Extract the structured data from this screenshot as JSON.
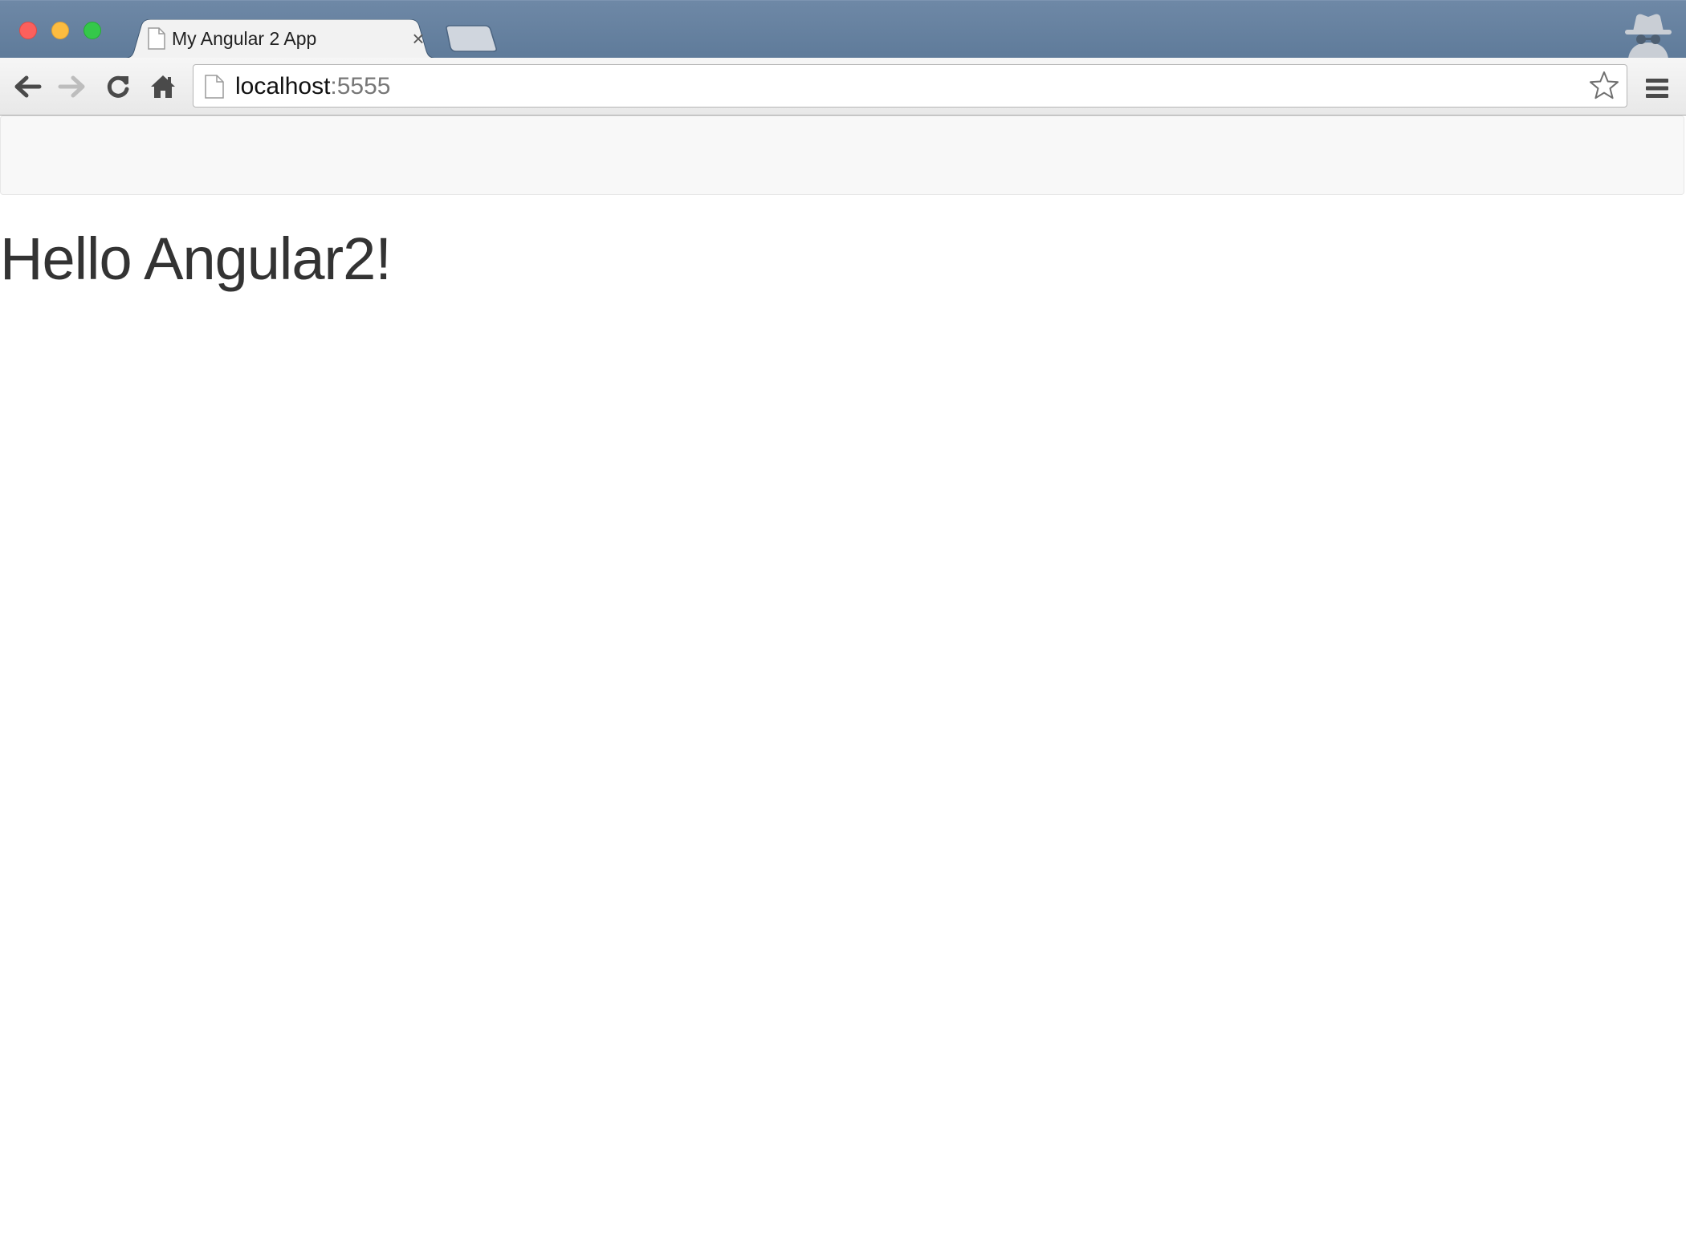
{
  "browser": {
    "tab": {
      "title": "My Angular 2 App",
      "close_glyph": "×",
      "icon": "page-icon"
    },
    "address_bar": {
      "host": "localhost",
      "port": ":5555"
    },
    "icons": {
      "back": "back-arrow-icon",
      "forward": "forward-arrow-icon",
      "reload": "reload-icon",
      "home": "home-icon",
      "bookmark": "star-icon",
      "menu": "hamburger-menu-icon",
      "profile": "incognito-icon"
    },
    "colors": {
      "titlebar": "#5f7b9a",
      "close": "#fc605c",
      "minimize": "#fdbc40",
      "maximize": "#34c84a"
    }
  },
  "page": {
    "heading": "Hello Angular2!",
    "colors": {
      "navbar_bg": "#f8f8f8",
      "navbar_border": "#e7e7e7",
      "heading_text": "#333333"
    }
  }
}
